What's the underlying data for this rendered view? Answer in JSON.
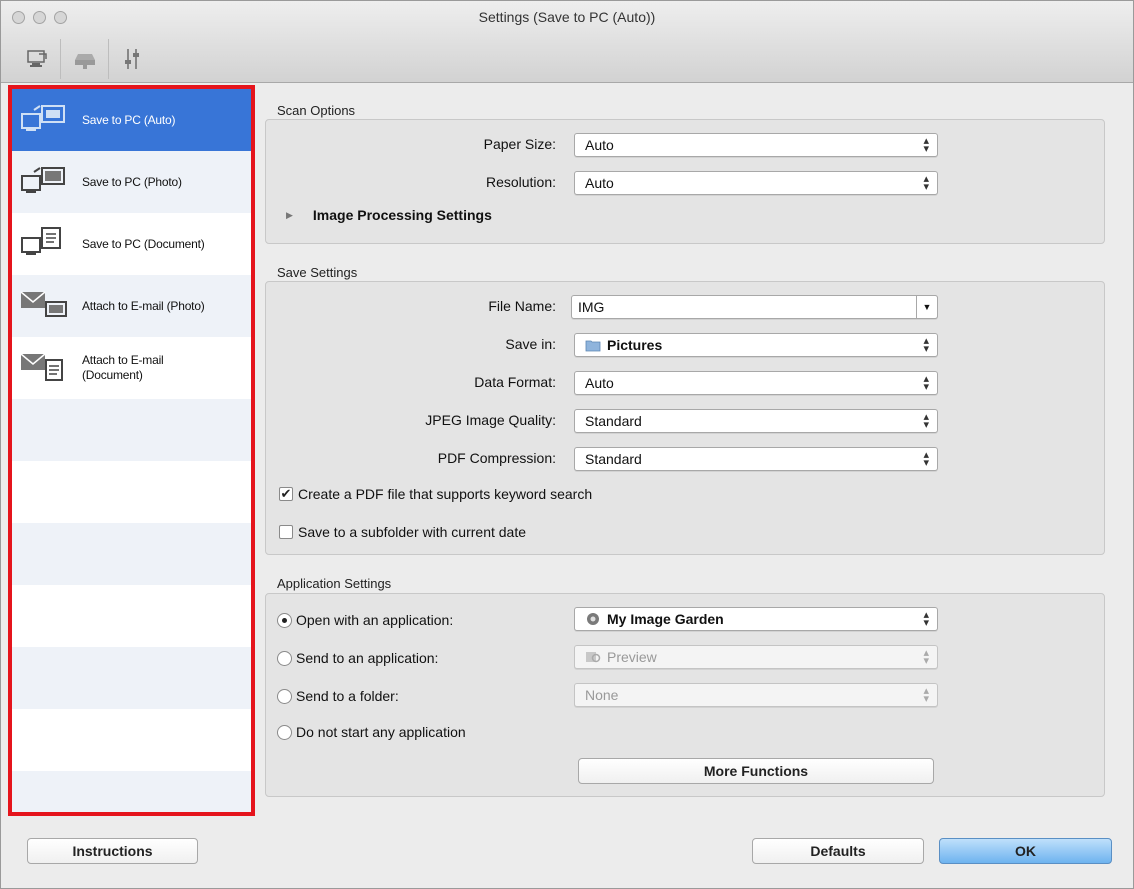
{
  "window": {
    "title": "Settings (Save to PC (Auto))"
  },
  "toolbar": {
    "tabs": [
      {
        "icon": "scan-from-computer-icon"
      },
      {
        "icon": "scan-from-operation-panel-icon"
      },
      {
        "icon": "general-settings-icon"
      }
    ]
  },
  "sidebar": {
    "items": [
      {
        "label": "Save to PC (Auto)",
        "icon": "save-to-pc-auto-icon",
        "selected": true
      },
      {
        "label": "Save to PC (Photo)",
        "icon": "save-to-pc-photo-icon"
      },
      {
        "label": "Save to PC (Document)",
        "icon": "save-to-pc-document-icon"
      },
      {
        "label": "Attach to E-mail (Photo)",
        "icon": "attach-email-photo-icon"
      },
      {
        "label_line1": "Attach to E-mail",
        "label_line2": "(Document)",
        "icon": "attach-email-document-icon"
      }
    ]
  },
  "scan_options": {
    "title": "Scan Options",
    "paper_size_label": "Paper Size:",
    "paper_size_value": "Auto",
    "resolution_label": "Resolution:",
    "resolution_value": "Auto",
    "image_processing_label": "Image Processing Settings"
  },
  "save_settings": {
    "title": "Save Settings",
    "file_name_label": "File Name:",
    "file_name_value": "IMG",
    "save_in_label": "Save in:",
    "save_in_value": "Pictures",
    "data_format_label": "Data Format:",
    "data_format_value": "Auto",
    "jpeg_quality_label": "JPEG Image Quality:",
    "jpeg_quality_value": "Standard",
    "pdf_compression_label": "PDF Compression:",
    "pdf_compression_value": "Standard",
    "keyword_search_label": "Create a PDF file that supports keyword search",
    "keyword_search_checked": true,
    "subfolder_label": "Save to a subfolder with current date",
    "subfolder_checked": false
  },
  "application_settings": {
    "title": "Application Settings",
    "open_with_label": "Open with an application:",
    "open_with_value": "My Image Garden",
    "open_with_selected": true,
    "send_to_app_label": "Send to an application:",
    "send_to_app_value": "Preview",
    "send_to_folder_label": "Send to a folder:",
    "send_to_folder_value": "None",
    "do_not_start_label": "Do not start any application",
    "more_functions_label": "More Functions"
  },
  "footer": {
    "instructions_label": "Instructions",
    "defaults_label": "Defaults",
    "ok_label": "OK"
  },
  "colors": {
    "highlight_border": "#e5141c",
    "selection": "#3875d7",
    "ok_button": "#6eb3ef"
  }
}
